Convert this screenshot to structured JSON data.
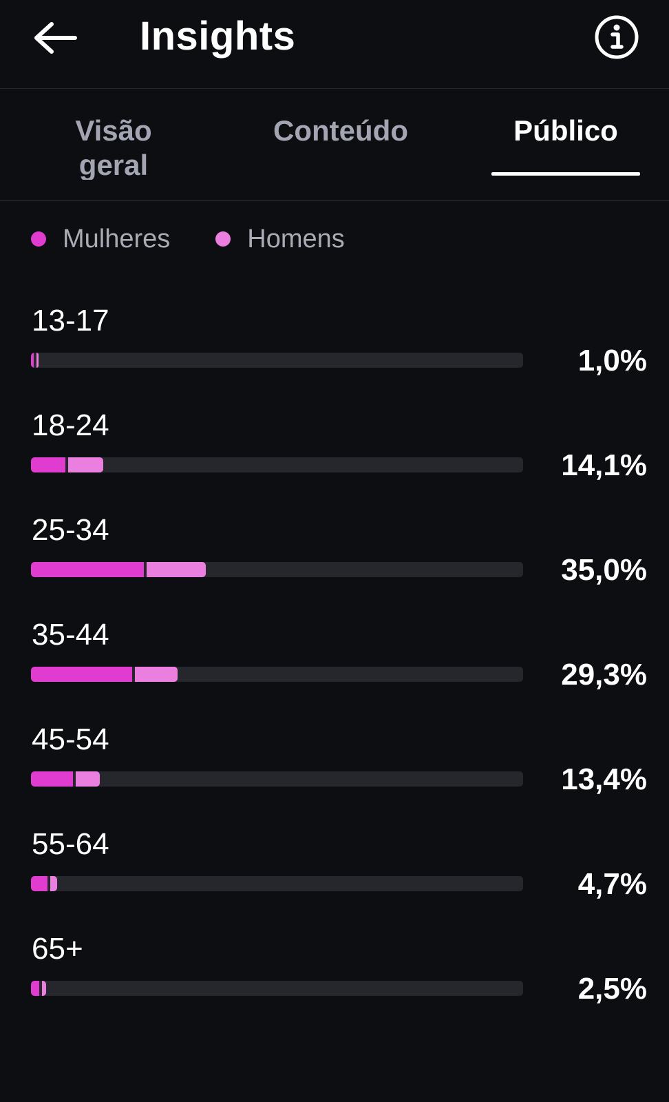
{
  "header": {
    "back_icon": "arrow-left-icon",
    "title": "Insights",
    "info_icon": "info-circle-icon"
  },
  "tabs": [
    {
      "label": "Visão geral",
      "active": false
    },
    {
      "label": "Conteúdo",
      "active": false
    },
    {
      "label": "Público",
      "active": true
    }
  ],
  "legend": [
    {
      "label": "Mulheres",
      "color": "#e03cd0"
    },
    {
      "label": "Homens",
      "color": "#ea7fdf"
    }
  ],
  "colors": {
    "women": "#e03cd0",
    "men": "#ea7fdf",
    "track": "#26272d",
    "background": "#0d0e12"
  },
  "age_groups": [
    {
      "label": "13-17",
      "percent": "1,0%",
      "total": 1.0,
      "women": 0.5,
      "men": 0.5
    },
    {
      "label": "18-24",
      "percent": "14,1%",
      "total": 14.1,
      "women": 7.0,
      "men": 7.1
    },
    {
      "label": "25-34",
      "percent": "35,0%",
      "total": 35.0,
      "women": 23.0,
      "men": 12.0
    },
    {
      "label": "35-44",
      "percent": "29,3%",
      "total": 29.3,
      "women": 20.6,
      "men": 8.7
    },
    {
      "label": "45-54",
      "percent": "13,4%",
      "total": 13.4,
      "women": 8.5,
      "men": 4.9
    },
    {
      "label": "55-64",
      "percent": "4,7%",
      "total": 4.7,
      "women": 3.3,
      "men": 1.4
    },
    {
      "label": "65+",
      "percent": "2,5%",
      "total": 2.5,
      "women": 1.7,
      "men": 0.8
    }
  ]
}
